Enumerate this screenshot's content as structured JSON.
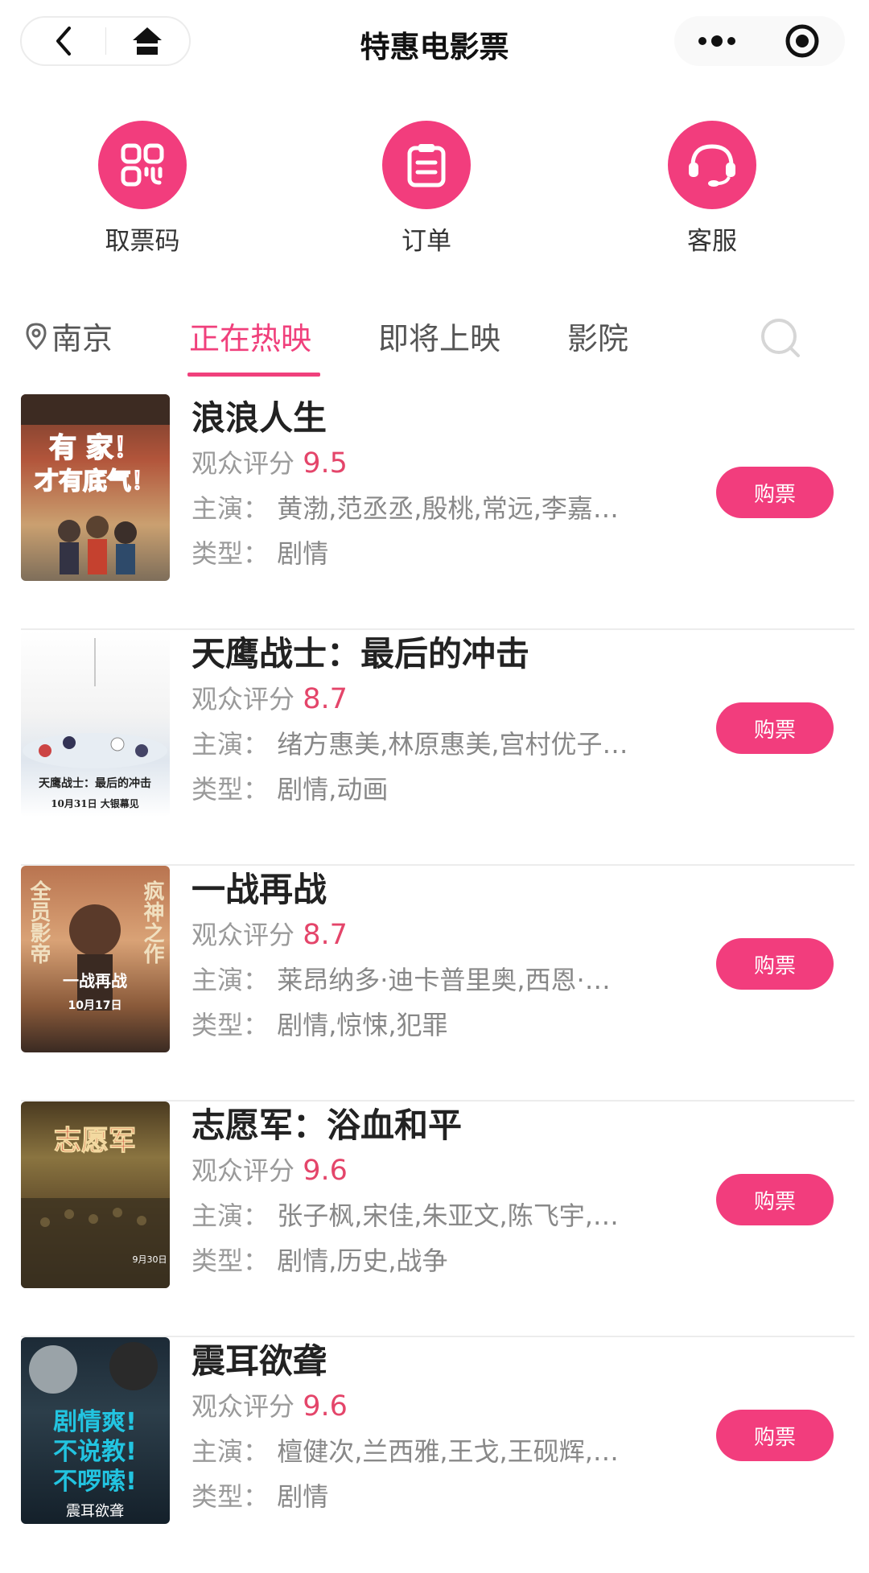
{
  "header": {
    "title": "特惠电影票",
    "back_icon": "chevron-left-icon",
    "home_icon": "home-icon",
    "more_icon": "more-dots-icon",
    "target_icon": "target-icon"
  },
  "quick_actions": [
    {
      "label": "取票码",
      "icon": "ticket-code-icon"
    },
    {
      "label": "订单",
      "icon": "clipboard-icon"
    },
    {
      "label": "客服",
      "icon": "headset-icon"
    }
  ],
  "location": {
    "city": "南京"
  },
  "tabs": [
    {
      "label": "正在热映",
      "active": true
    },
    {
      "label": "即将上映",
      "active": false
    },
    {
      "label": "影院",
      "active": false
    }
  ],
  "labels": {
    "rating": "观众评分",
    "cast": "主演：",
    "genre": "类型：",
    "buy": "购票"
  },
  "colors": {
    "accent": "#f23d7d",
    "score": "#e4456a"
  },
  "movies": [
    {
      "title": "浪浪人生",
      "score": "9.5",
      "cast": "黄渤,范丞丞,殷桃,常远,李嘉…",
      "genre": "剧情",
      "poster_text": [
        "有 家！",
        "才有底气！"
      ]
    },
    {
      "title": "天鹰战士：最后的冲击",
      "score": "8.7",
      "cast": "绪方惠美,林原惠美,宫村优子…",
      "genre": "剧情,动画",
      "poster_text": [
        "天鹰战士：最后的冲击",
        "10月31日 大银幕见"
      ]
    },
    {
      "title": "一战再战",
      "score": "8.7",
      "cast": "莱昂纳多·迪卡普里奥,西恩·…",
      "genre": "剧情,惊悚,犯罪",
      "poster_text": [
        "全员影帝",
        "疯神之作",
        "一战再战",
        "10月17日"
      ]
    },
    {
      "title": "志愿军：浴血和平",
      "score": "9.6",
      "cast": "张子枫,宋佳,朱亚文,陈飞宇,…",
      "genre": "剧情,历史,战争",
      "poster_text": [
        "志愿军",
        "9月30日"
      ]
    },
    {
      "title": "震耳欲聋",
      "score": "9.6",
      "cast": "檀健次,兰西雅,王戈,王砚辉,…",
      "genre": "剧情",
      "poster_text": [
        "剧情爽!",
        "不说教!",
        "不啰嗦!",
        "震耳欲聋"
      ]
    }
  ]
}
